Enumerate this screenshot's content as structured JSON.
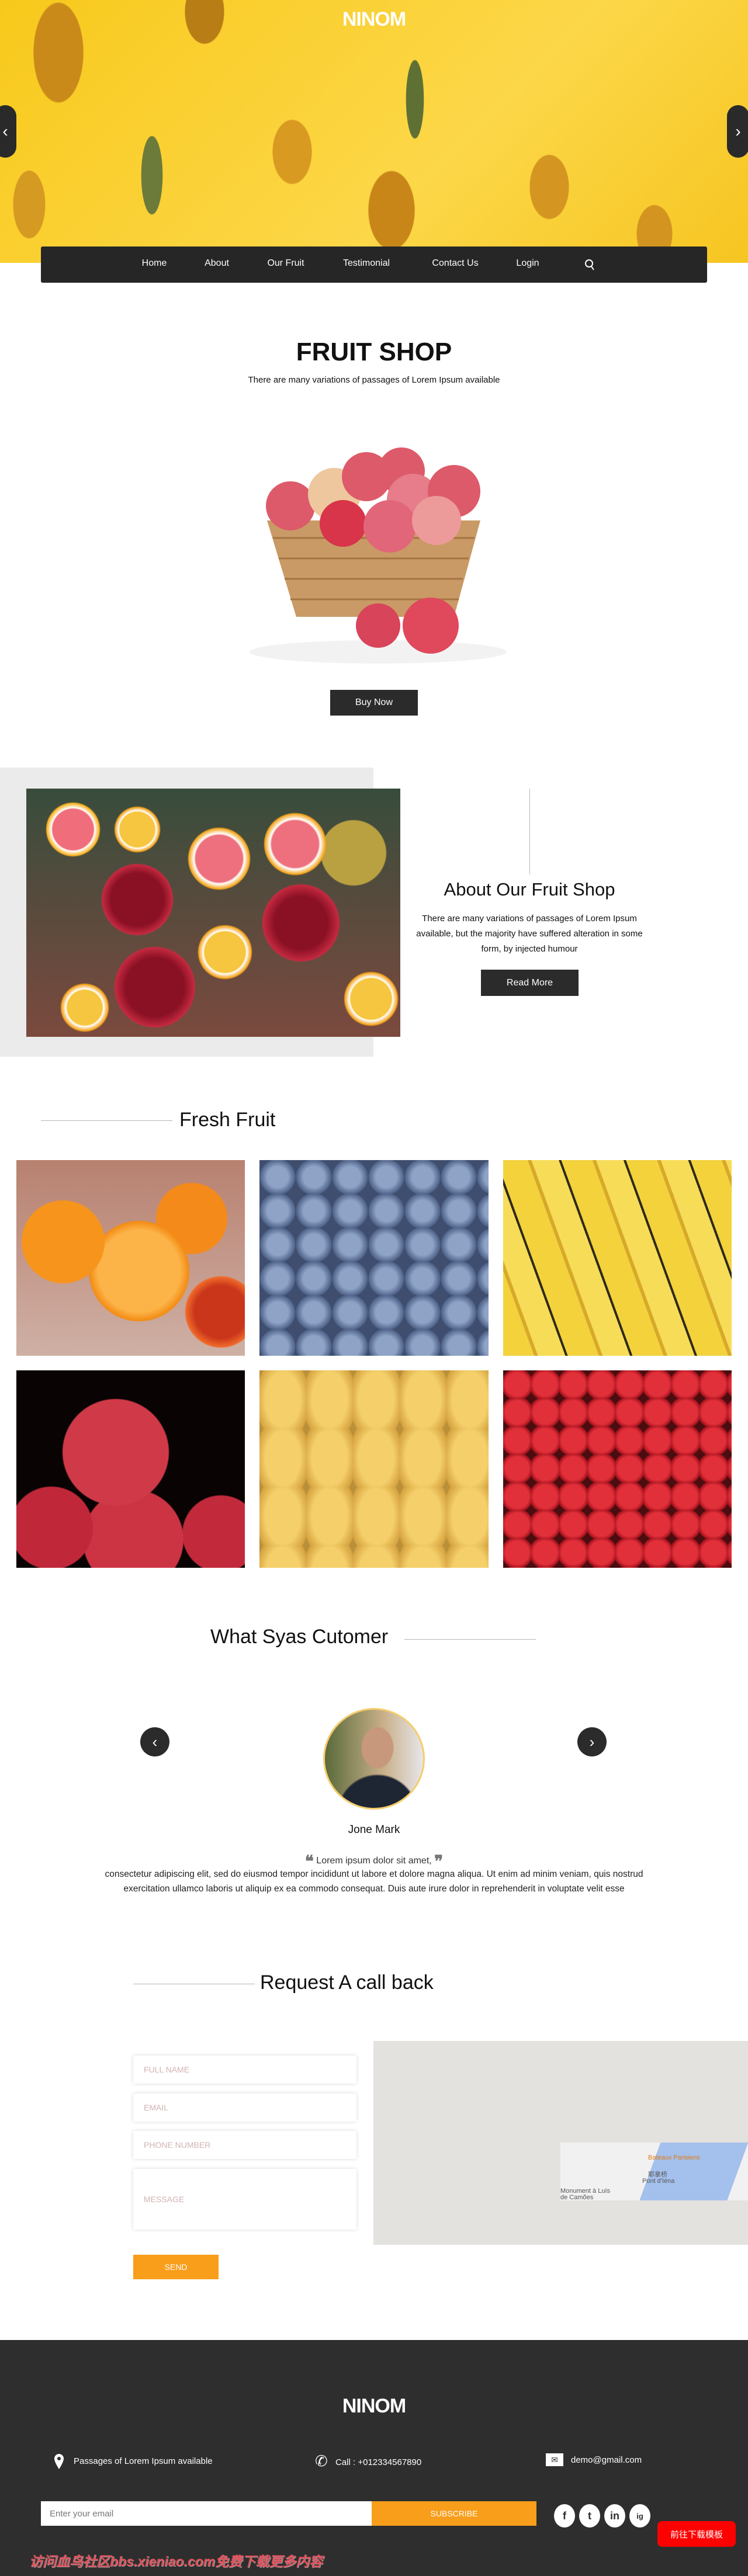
{
  "brand": "NINOM",
  "nav": {
    "items": [
      "Home",
      "About",
      "Our Fruit",
      "Testimonial",
      "Contact Us",
      "Login"
    ],
    "search_icon": "search-icon"
  },
  "hero": {
    "prev_icon": "chevron-left-icon",
    "next_icon": "chevron-right-icon"
  },
  "shop": {
    "title": "FRUIT SHOP",
    "subtitle": "There are many variations of passages of Lorem Ipsum available",
    "button": "Buy Now"
  },
  "about": {
    "title": "About Our Fruit Shop",
    "text": "There are many variations of passages of Lorem Ipsum available, but the majority have suffered alteration in some form, by injected humour",
    "button": "Read More"
  },
  "fresh": {
    "title": "Fresh Fruit",
    "items": [
      "orange",
      "blueberry",
      "banana",
      "apple",
      "mango",
      "strawberry"
    ]
  },
  "testimonial": {
    "title": "What Syas Cutomer",
    "name": "Jone Mark",
    "quote": "Lorem ipsum dolor sit amet,",
    "text": "consectetur adipiscing elit, sed do eiusmod tempor incididunt ut labore et dolore magna aliqua. Ut enim ad minim veniam, quis nostrud exercitation ullamco laboris ut aliquip ex ea commodo consequat. Duis aute irure dolor in reprehenderit in voluptate velit esse"
  },
  "contact": {
    "title": "Request A call back",
    "placeholders": {
      "name": "FULL NAME",
      "email": "EMAIL",
      "phone": "PHONE NUMBER",
      "message": "MESSAGE"
    },
    "send": "SEND",
    "map": {
      "label1": "Bateaux Parisiens",
      "label2": "耶拿桥",
      "label3": "Pont d'Iéna",
      "label4": "Monument à Luís de Camões"
    }
  },
  "footer": {
    "brand": "NINOM",
    "address": "Passages of Lorem Ipsum available",
    "phone": "Call : +012334567890",
    "email": "demo@gmail.com",
    "email_placeholder": "Enter your email",
    "subscribe": "SUBSCRIBE",
    "social": [
      "f",
      "t",
      "in",
      "ig"
    ]
  },
  "overlay": {
    "watermark": "访问血鸟社区bbs.xieniao.com免费下载更多内容",
    "download": "前往下载模板"
  },
  "colors": {
    "accent": "#f89e1b",
    "dark": "#2e2e2e"
  }
}
